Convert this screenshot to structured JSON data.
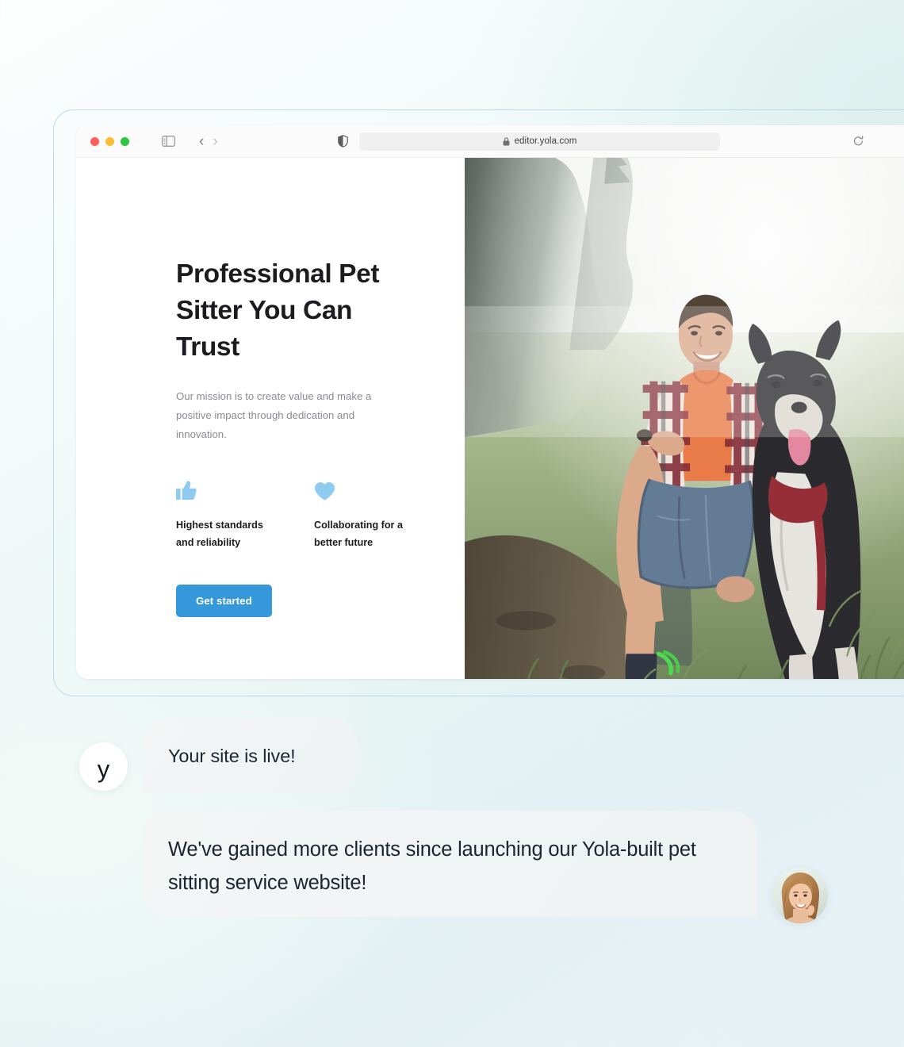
{
  "browser": {
    "url": "editor.yola.com",
    "traffic_lights": [
      "close",
      "minimize",
      "zoom"
    ],
    "icons": {
      "sidebar": "sidebar-toggle-icon",
      "back": "‹",
      "forward": "›",
      "shield": "privacy-shield-icon",
      "lock": "lock-icon",
      "reload": "reload-icon"
    }
  },
  "site": {
    "hero": {
      "title": "Professional Pet Sitter You Can Trust",
      "subtitle": "Our mission is to create value and make a positive impact through dedication and innovation.",
      "cta_label": "Get started"
    },
    "features": [
      {
        "icon": "thumbs-up-icon",
        "label": "Highest standards and reliability"
      },
      {
        "icon": "heart-icon",
        "label": "Collaborating for a better future"
      }
    ],
    "photo_alt": "Smiling man kneeling in a foggy grass field beside a black and white border collie"
  },
  "chat": {
    "brand_initial": "y",
    "messages": [
      {
        "from": "yola",
        "text": "Your site is live!"
      },
      {
        "from": "customer",
        "text": "We've gained more clients since launching our Yola-built pet sitting service website!"
      }
    ],
    "customer_avatar_alt": "Smiling woman with light brown wavy hair"
  },
  "colors": {
    "accent_button": "#3498db",
    "feature_icon": "#8fcaf0",
    "frame_border": "#b9dced",
    "bubble_bg": "#f1f4f5",
    "heading": "#1c1c20",
    "body_text": "#8b8b91"
  }
}
